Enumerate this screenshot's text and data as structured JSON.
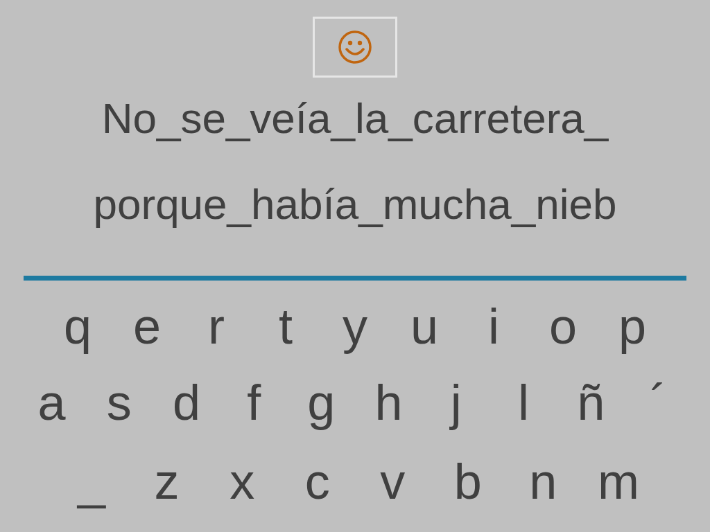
{
  "lines": [
    "No_se_veía_la_carretera_",
    "porque_había_mucha_nieb"
  ],
  "keyboard": [
    [
      "q",
      "e",
      "r",
      "t",
      "y",
      "u",
      "i",
      "o",
      "p"
    ],
    [
      "a",
      "s",
      "d",
      "f",
      "g",
      "h",
      "j",
      "l",
      "ñ",
      "´"
    ],
    [
      "_",
      "z",
      "x",
      "c",
      "v",
      "b",
      "n",
      "m"
    ]
  ]
}
